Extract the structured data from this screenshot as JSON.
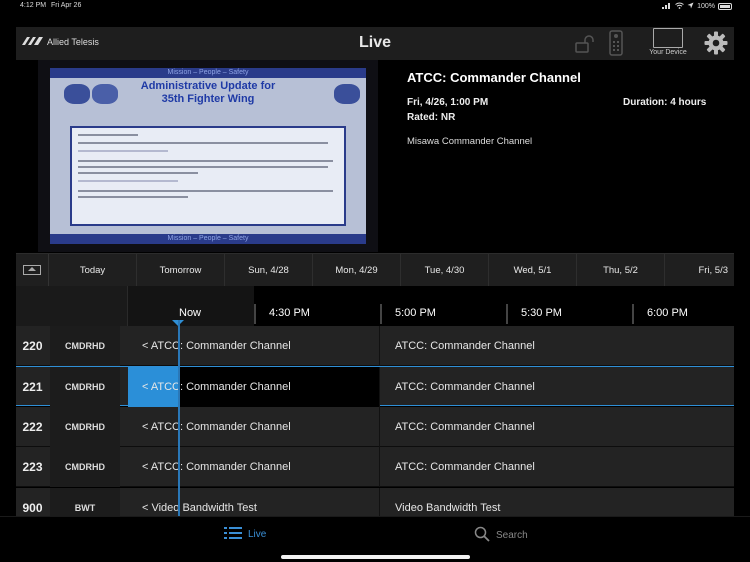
{
  "status": {
    "time": "4:12 PM",
    "date": "Fri Apr 26",
    "battery": "100%"
  },
  "header": {
    "brand": "Allied Telesis",
    "title": "Live",
    "device_label": "Your Device"
  },
  "program": {
    "title": "ATCC: Commander Channel",
    "datetime": "Fri, 4/26, 1:00 PM",
    "duration": "Duration: 4 hours",
    "rating": "Rated: NR",
    "description": "Misawa Commander Channel"
  },
  "preview": {
    "top_banner": "Mission – People – Safety",
    "headline_1": "Administrative Update for",
    "headline_2": "35th Fighter Wing",
    "bottom_banner": "Mission – People – Safety"
  },
  "days": [
    "Today",
    "Tomorrow",
    "Sun, 4/28",
    "Mon, 4/29",
    "Tue, 4/30",
    "Wed, 5/1",
    "Thu, 5/2",
    "Fri, 5/3"
  ],
  "times": [
    "Now",
    "4:30 PM",
    "5:00 PM",
    "5:30 PM",
    "6:00 PM"
  ],
  "channels": [
    {
      "num": "220",
      "name": "CMDRHD",
      "p1": "< ATCC: Commander Channel",
      "p2": "ATCC: Commander Channel"
    },
    {
      "num": "221",
      "name": "CMDRHD",
      "p1": "< ATCC: Commander Channel",
      "p2": "ATCC: Commander Channel"
    },
    {
      "num": "222",
      "name": "CMDRHD",
      "p1": "< ATCC: Commander Channel",
      "p2": "ATCC: Commander Channel"
    },
    {
      "num": "223",
      "name": "CMDRHD",
      "p1": "< ATCC: Commander Channel",
      "p2": "ATCC: Commander Channel"
    },
    {
      "num": "900",
      "name": "BWT",
      "p1": "< Video Bandwidth Test",
      "p2": "Video Bandwidth Test"
    }
  ],
  "tabs": {
    "live": "Live",
    "search": "Search"
  },
  "colors": {
    "accent": "#2f8fd6",
    "background": "#000000",
    "row": "#232323"
  }
}
